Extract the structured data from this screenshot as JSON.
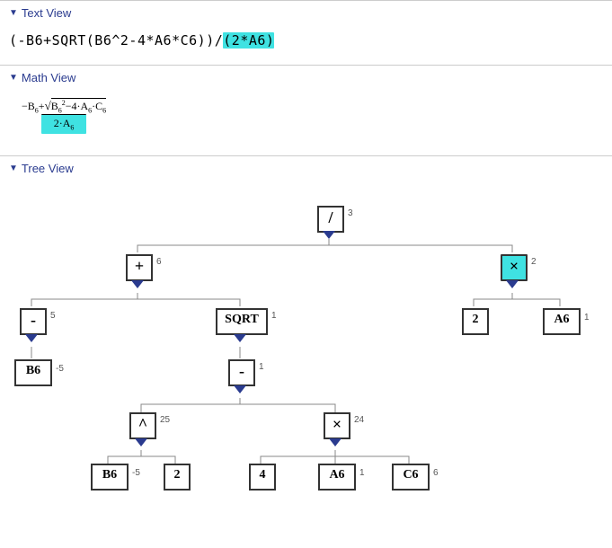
{
  "sections": {
    "text": {
      "title": "Text View"
    },
    "math": {
      "title": "Math View"
    },
    "tree": {
      "title": "Tree View"
    }
  },
  "text_view": {
    "prefix": "(-B6+SQRT(B6^2-4*A6*C6))/",
    "highlight": "(2*A6)"
  },
  "math_view": {
    "num_prefix": "−B",
    "b_sub": "6",
    "plus": "+",
    "sqrt_content_b": "B",
    "sqrt_b_sub": "6",
    "sqrt_b_sup": "2",
    "minus4": "−4·A",
    "a_sub": "6",
    "dotC": "·C",
    "c_sub": "6",
    "den_2a": "2·A",
    "den_sub": "6"
  },
  "tree": {
    "div": {
      "label": "/",
      "val": "3"
    },
    "plus": {
      "label": "+",
      "val": "6"
    },
    "times": {
      "label": "×",
      "val": "2"
    },
    "neg": {
      "label": "-",
      "val": "5"
    },
    "sqrt": {
      "label": "SQRT",
      "val": "1"
    },
    "two": {
      "label": "2",
      "val": ""
    },
    "a6r": {
      "label": "A6",
      "val": "1"
    },
    "b6t": {
      "label": "B6",
      "val": "-5"
    },
    "aux": {
      "label": "-",
      "val": "1"
    },
    "pow": {
      "label": "^",
      "val": "25"
    },
    "mul": {
      "label": "×",
      "val": "24"
    },
    "b6b": {
      "label": "B6",
      "val": "-5"
    },
    "two2": {
      "label": "2",
      "val": ""
    },
    "four": {
      "label": "4",
      "val": ""
    },
    "a6b": {
      "label": "A6",
      "val": "1"
    },
    "c6": {
      "label": "C6",
      "val": "6"
    }
  }
}
